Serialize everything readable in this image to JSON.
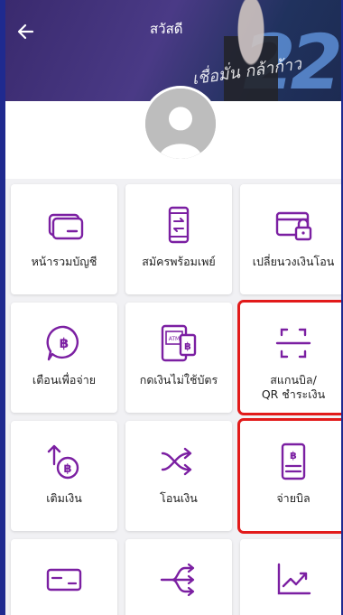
{
  "header": {
    "title": "สวัสดี"
  },
  "tiles": [
    {
      "label": "หน้ารวมบัญชี",
      "icon": "account-card-icon"
    },
    {
      "label": "สมัครพร้อมเพย์",
      "icon": "promptpay-phone-icon"
    },
    {
      "label": "เปลี่ยนวงเงินโอน",
      "icon": "transfer-limit-lock-icon"
    },
    {
      "label": "เตือนเพื่อจ่าย",
      "icon": "baht-coin-reminder-icon"
    },
    {
      "label": "กดเงินไม่ใช้บัตร",
      "icon": "cardless-atm-icon"
    },
    {
      "label": "สแกนบิล/\nQR ชำระเงิน",
      "icon": "scan-qr-icon"
    },
    {
      "label": "เติมเงิน",
      "icon": "topup-baht-icon"
    },
    {
      "label": "โอนเงิน",
      "icon": "transfer-arrows-icon"
    },
    {
      "label": "จ่ายบิล",
      "icon": "bill-pay-icon"
    },
    {
      "label": "",
      "icon": "card-icon"
    },
    {
      "label": "",
      "icon": "split-arrows-icon"
    },
    {
      "label": "",
      "icon": "chart-trend-icon"
    }
  ],
  "colors": {
    "accent": "#7b1fa2",
    "highlight": "#e21a1a",
    "sidebar": "#1f2a8f"
  }
}
